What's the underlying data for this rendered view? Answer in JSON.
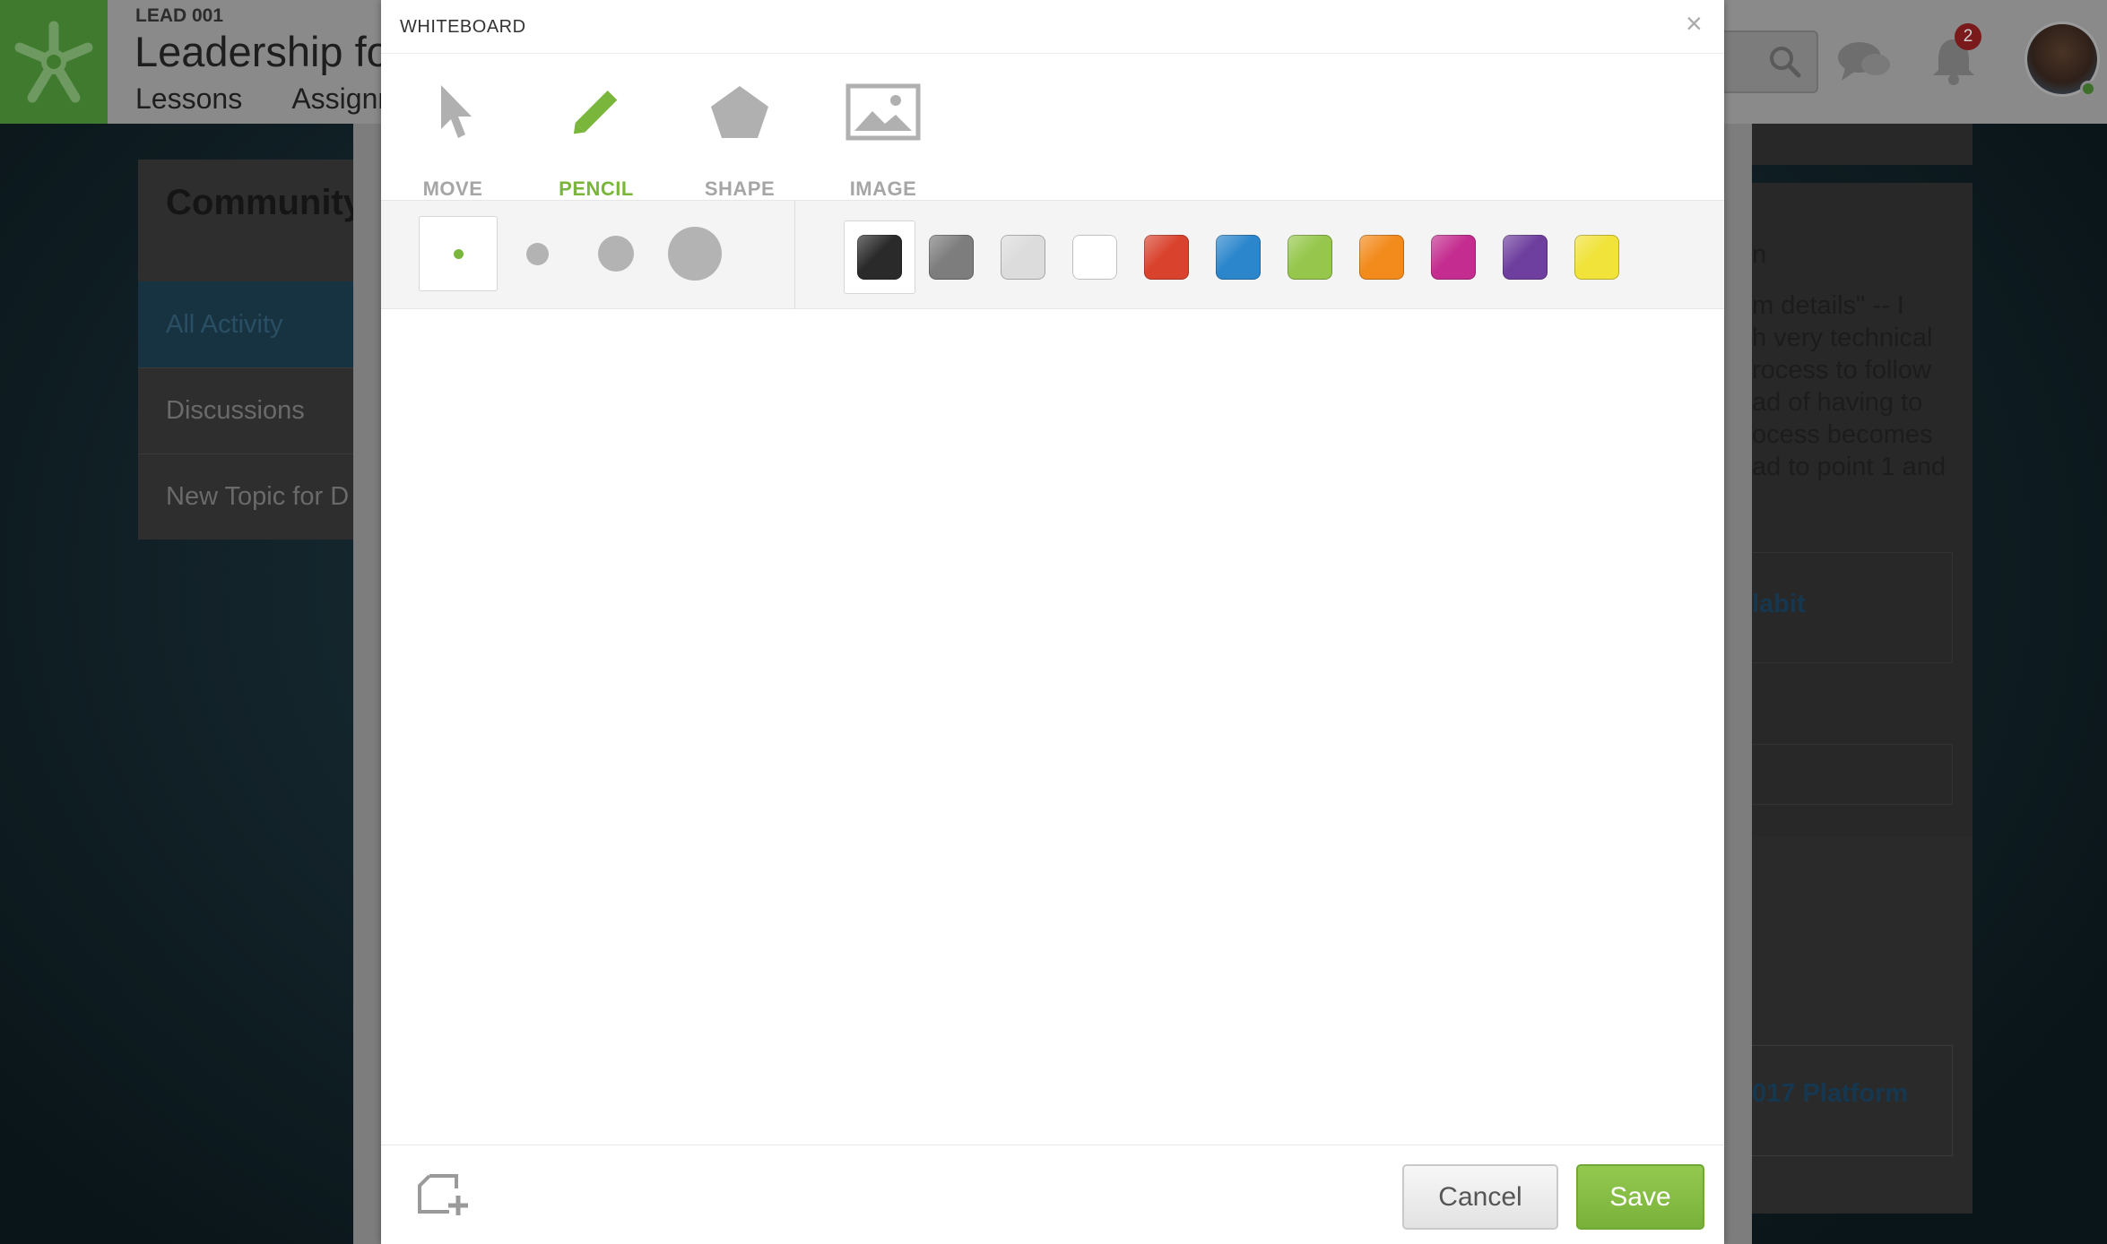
{
  "app": {
    "course_code": "LEAD 001",
    "course_title": "Leadership fo",
    "nav": [
      "Lessons",
      "Assignn"
    ],
    "notification_count": "2"
  },
  "community": {
    "title": "Community",
    "items": [
      {
        "label": "All Activity",
        "active": true
      },
      {
        "label": "Discussions",
        "active": false
      },
      {
        "label": "New Topic for D",
        "active": false
      }
    ]
  },
  "right_panel": {
    "lines": [
      "n",
      "m details\" -- I",
      "h very technical",
      "rocess to follow",
      "ad of having to",
      "ocess becomes",
      "ad to point 1 and"
    ],
    "link1": "labit",
    "link2": "017 Platform"
  },
  "whiteboard": {
    "title": "WHITEBOARD",
    "close_symbol": "×",
    "tools": [
      {
        "label": "MOVE",
        "icon": "cursor-arrow-icon",
        "active": false
      },
      {
        "label": "PENCIL",
        "icon": "pencil-icon",
        "active": true
      },
      {
        "label": "SHAPE",
        "icon": "pentagon-icon",
        "active": false
      },
      {
        "label": "IMAGE",
        "icon": "image-icon",
        "active": false
      }
    ],
    "brush_sizes": [
      {
        "name": "extra-small",
        "selected": true
      },
      {
        "name": "small",
        "selected": false
      },
      {
        "name": "medium",
        "selected": false
      },
      {
        "name": "large",
        "selected": false
      }
    ],
    "colors": [
      {
        "name": "black",
        "hex": "#2a2a2a",
        "selected": true
      },
      {
        "name": "dark-gray",
        "hex": "#7d7d7d",
        "selected": false
      },
      {
        "name": "light-gray",
        "hex": "#dcdcdc",
        "selected": false
      },
      {
        "name": "white",
        "hex": "#ffffff",
        "selected": false
      },
      {
        "name": "red",
        "hex": "#d9422d",
        "selected": false
      },
      {
        "name": "blue",
        "hex": "#2b86cc",
        "selected": false
      },
      {
        "name": "green",
        "hex": "#96c74c",
        "selected": false
      },
      {
        "name": "orange",
        "hex": "#f38a1c",
        "selected": false
      },
      {
        "name": "magenta",
        "hex": "#c42d8f",
        "selected": false
      },
      {
        "name": "purple",
        "hex": "#6e3f9e",
        "selected": false
      },
      {
        "name": "yellow",
        "hex": "#f1e33a",
        "selected": false
      }
    ],
    "cancel_label": "Cancel",
    "save_label": "Save",
    "accent_color": "#7ab63c"
  }
}
